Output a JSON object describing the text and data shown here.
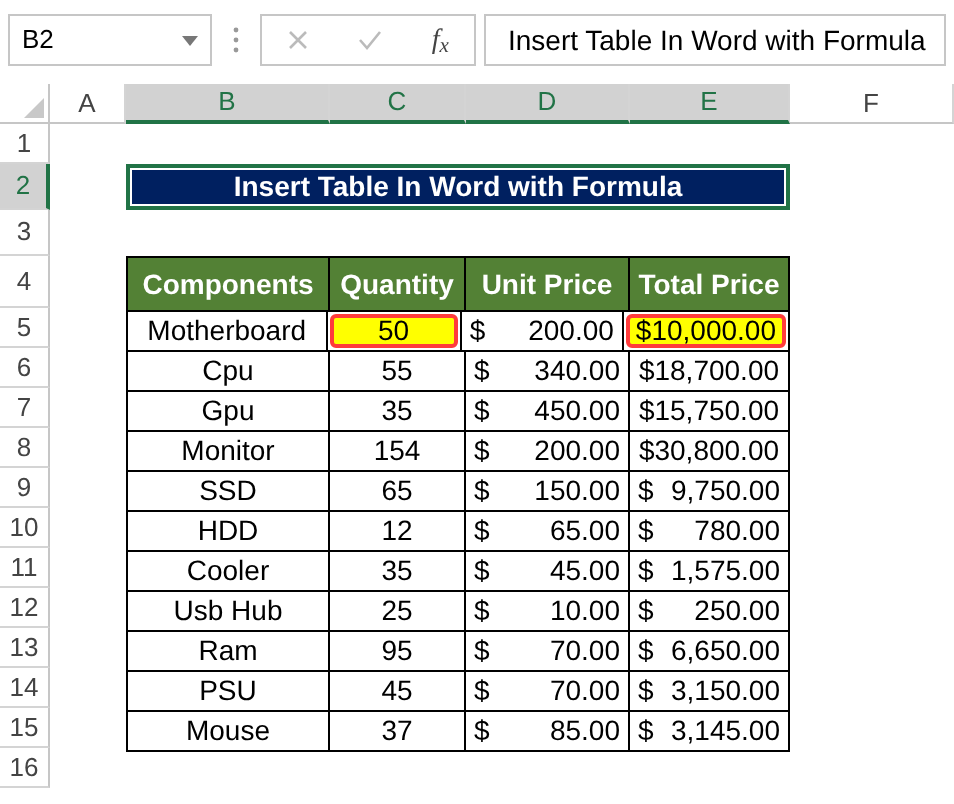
{
  "formula_bar": {
    "name_box": "B2",
    "function_label": "f$_{x}$",
    "formula": "Insert Table In Word with Formula"
  },
  "column_headers": [
    {
      "label": "A",
      "selected": false
    },
    {
      "label": "B",
      "selected": true
    },
    {
      "label": "C",
      "selected": true
    },
    {
      "label": "D",
      "selected": true
    },
    {
      "label": "E",
      "selected": true
    },
    {
      "label": "F",
      "selected": false
    }
  ],
  "row_headers": [
    {
      "label": "1",
      "selected": false
    },
    {
      "label": "2",
      "selected": true
    },
    {
      "label": "3",
      "selected": false
    },
    {
      "label": "4",
      "selected": false
    },
    {
      "label": "5",
      "selected": false
    },
    {
      "label": "6",
      "selected": false
    },
    {
      "label": "7",
      "selected": false
    },
    {
      "label": "8",
      "selected": false
    },
    {
      "label": "9",
      "selected": false
    },
    {
      "label": "10",
      "selected": false
    },
    {
      "label": "11",
      "selected": false
    },
    {
      "label": "12",
      "selected": false
    },
    {
      "label": "13",
      "selected": false
    },
    {
      "label": "14",
      "selected": false
    },
    {
      "label": "15",
      "selected": false
    },
    {
      "label": "16",
      "selected": false
    }
  ],
  "title": "Insert Table In Word with Formula",
  "table": {
    "columns": [
      "Components",
      "Quantity",
      "Unit Price",
      "Total Price"
    ],
    "rows": [
      {
        "component": "Motherboard",
        "quantity": {
          "text": "50",
          "highlighted": true
        },
        "unit_price": {
          "symbol": "$",
          "amount": "200.00"
        },
        "total": {
          "kind": "plain",
          "text": "$10,000.00",
          "highlighted": true
        }
      },
      {
        "component": "Cpu",
        "quantity": {
          "text": "55",
          "highlighted": false
        },
        "unit_price": {
          "symbol": "$",
          "amount": "340.00"
        },
        "total": {
          "kind": "plain",
          "text": "$18,700.00",
          "highlighted": false
        }
      },
      {
        "component": "Gpu",
        "quantity": {
          "text": "35",
          "highlighted": false
        },
        "unit_price": {
          "symbol": "$",
          "amount": "450.00"
        },
        "total": {
          "kind": "plain",
          "text": "$15,750.00",
          "highlighted": false
        }
      },
      {
        "component": "Monitor",
        "quantity": {
          "text": "154",
          "highlighted": false
        },
        "unit_price": {
          "symbol": "$",
          "amount": "200.00"
        },
        "total": {
          "kind": "plain",
          "text": "$30,800.00",
          "highlighted": false
        }
      },
      {
        "component": "SSD",
        "quantity": {
          "text": "65",
          "highlighted": false
        },
        "unit_price": {
          "symbol": "$",
          "amount": "150.00"
        },
        "total": {
          "kind": "accounting",
          "symbol": "$",
          "text": "9,750.00",
          "highlighted": false
        }
      },
      {
        "component": "HDD",
        "quantity": {
          "text": "12",
          "highlighted": false
        },
        "unit_price": {
          "symbol": "$",
          "amount": "65.00"
        },
        "total": {
          "kind": "accounting",
          "symbol": "$",
          "text": "780.00",
          "highlighted": false
        }
      },
      {
        "component": "Cooler",
        "quantity": {
          "text": "35",
          "highlighted": false
        },
        "unit_price": {
          "symbol": "$",
          "amount": "45.00"
        },
        "total": {
          "kind": "accounting",
          "symbol": "$",
          "text": "1,575.00",
          "highlighted": false
        }
      },
      {
        "component": "Usb Hub",
        "quantity": {
          "text": "25",
          "highlighted": false
        },
        "unit_price": {
          "symbol": "$",
          "amount": "10.00"
        },
        "total": {
          "kind": "accounting",
          "symbol": "$",
          "text": "250.00",
          "highlighted": false
        }
      },
      {
        "component": "Ram",
        "quantity": {
          "text": "95",
          "highlighted": false
        },
        "unit_price": {
          "symbol": "$",
          "amount": "70.00"
        },
        "total": {
          "kind": "accounting",
          "symbol": "$",
          "text": "6,650.00",
          "highlighted": false
        }
      },
      {
        "component": "PSU",
        "quantity": {
          "text": "45",
          "highlighted": false
        },
        "unit_price": {
          "symbol": "$",
          "amount": "70.00"
        },
        "total": {
          "kind": "accounting",
          "symbol": "$",
          "text": "3,150.00",
          "highlighted": false
        }
      },
      {
        "component": "Mouse",
        "quantity": {
          "text": "37",
          "highlighted": false
        },
        "unit_price": {
          "symbol": "$",
          "amount": "85.00"
        },
        "total": {
          "kind": "accounting",
          "symbol": "$",
          "text": "3,145.00",
          "highlighted": false
        }
      }
    ]
  }
}
